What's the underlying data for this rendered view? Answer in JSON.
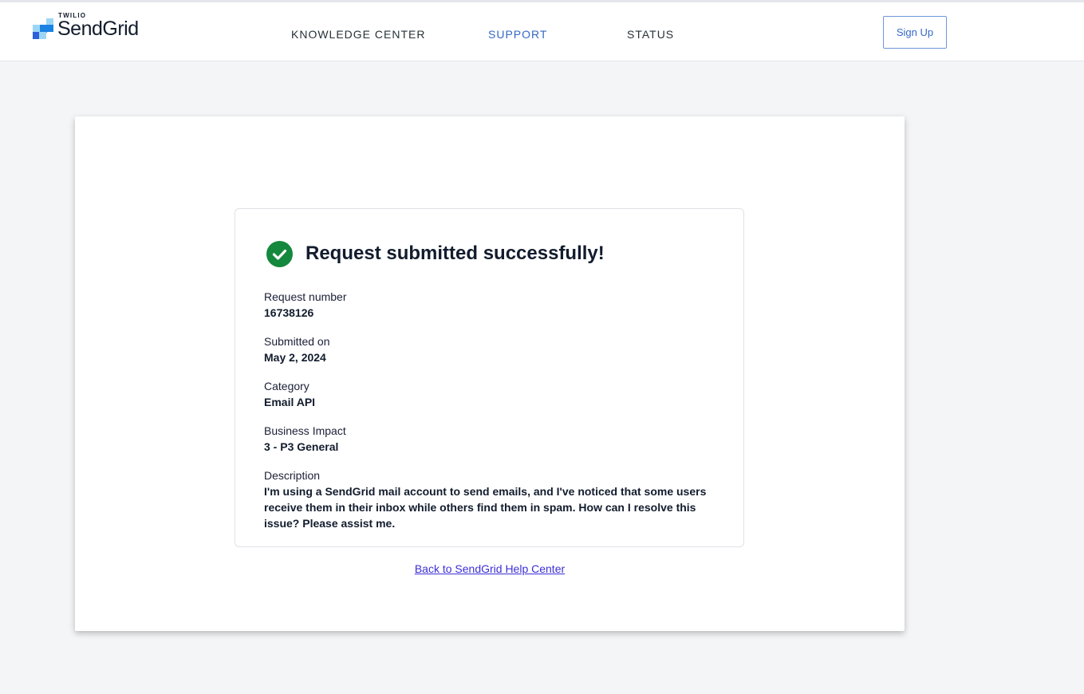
{
  "header": {
    "logo": {
      "brand_small": "TWILIO",
      "brand_name": "SendGrid"
    },
    "nav": [
      {
        "label": "KNOWLEDGE CENTER",
        "active": false
      },
      {
        "label": "SUPPORT",
        "active": true
      },
      {
        "label": "STATUS",
        "active": false
      }
    ],
    "signup_label": "Sign Up"
  },
  "confirmation": {
    "status_icon": "check-circle-icon",
    "title": "Request submitted successfully!",
    "fields": [
      {
        "label": "Request number",
        "value": "16738126"
      },
      {
        "label": "Submitted on",
        "value": "May 2, 2024"
      },
      {
        "label": "Category",
        "value": "Email API"
      },
      {
        "label": "Business Impact",
        "value": "3 - P3 General"
      },
      {
        "label": "Description",
        "value": "I'm using a SendGrid mail account to send emails, and I've noticed that some users receive them in their inbox while others find them in spam. How can I resolve this issue? Please assist me."
      }
    ],
    "back_link_label": "Back to SendGrid Help Center"
  },
  "colors": {
    "accent": "#3368c6",
    "success": "#14883c",
    "page_background": "#f4f5f7",
    "link": "#3b2fd6"
  }
}
